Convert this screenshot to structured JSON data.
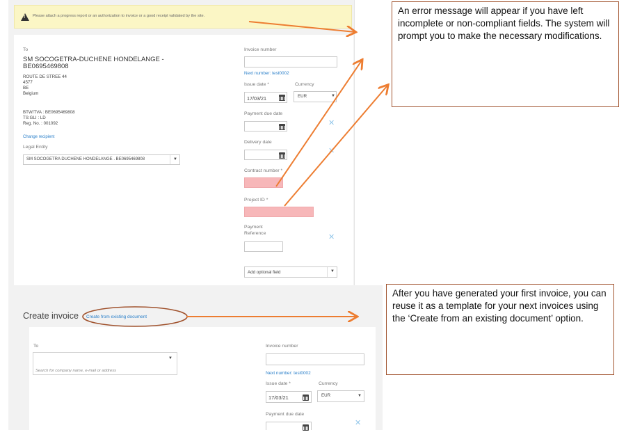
{
  "error_alert": {
    "text": "Please attach a progress report or an authorization to invoice or a good receipt validated by the site."
  },
  "filled_form": {
    "to_label": "To",
    "recipient_name_line1": "SM SOCOGETRA-DUCHENE HONDELANGE -",
    "recipient_name_line2": "BE0695469808",
    "address_lines": [
      "ROUTE DE STREE 44",
      "4577",
      "BE",
      "Belgium"
    ],
    "id_lines": [
      "BTW/TVA : BE0695469808",
      "TS:GLI : LD",
      "Reg. No. : 001092"
    ],
    "change_recipient": "Change recipient",
    "legal_entity_label": "Legal Entity",
    "legal_entity_value": "SM SOCOGETRA DUCHENE HONDELANGE . BE0695469808",
    "invoice_number_label": "Invoice number",
    "next_number": "Next number: test0002",
    "issue_date_label": "Issue date *",
    "issue_date_value": "17/03/21",
    "currency_label": "Currency",
    "currency_value": "EUR",
    "payment_due_label": "Payment due date",
    "delivery_date_label": "Delivery date",
    "contract_number_label": "Contract number *",
    "project_id_label": "Project ID *",
    "payment_reference_label_1": "Payment",
    "payment_reference_label_2": "Reference",
    "add_optional_field": "Add optional field"
  },
  "create_form": {
    "title": "Create invoice",
    "create_from_existing": "Create from existing document",
    "to_label": "To",
    "search_placeholder": "Search for company name, e-mail or address",
    "invoice_number_label": "Invoice number",
    "next_number": "Next number: test0002",
    "issue_date_label": "Issue date *",
    "issue_date_value": "17/03/21",
    "currency_label": "Currency",
    "currency_value": "EUR",
    "payment_due_label": "Payment due date"
  },
  "annotations": {
    "note1": "An error message will appear if you have left incomplete or non-compliant fields. The system will prompt you to make the necessary modifications.",
    "note2": "After you have generated your first invoice, you can reuse it as a template for your next invoices using the ‘Create from an existing document’ option."
  },
  "colors": {
    "error_field": "#f7b7b9",
    "alert_bg": "#fbf6c5",
    "arrow": "#ed7d31",
    "link": "#2a7fc9",
    "note_border": "#a0522d"
  }
}
